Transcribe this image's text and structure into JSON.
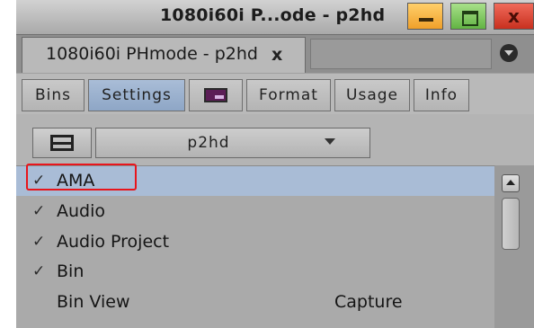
{
  "window": {
    "title": "1080i60i P...ode - p2hd",
    "close_glyph": "x"
  },
  "doc_tab": {
    "label": "1080i60i PHmode - p2hd",
    "close_glyph": "x"
  },
  "subtabs": [
    {
      "label": "Bins",
      "active": false
    },
    {
      "label": "Settings",
      "active": true
    },
    {
      "label": "",
      "icon": "monitor-icon",
      "active": false
    },
    {
      "label": "Format",
      "active": false
    },
    {
      "label": "Usage",
      "active": false
    },
    {
      "label": "Info",
      "active": false
    }
  ],
  "toolbar": {
    "view_toggle_icon": "split-view-icon",
    "settings_dropdown_value": "p2hd"
  },
  "settings_list": [
    {
      "label": "AMA",
      "checked": true,
      "value": "",
      "selected": true
    },
    {
      "label": "Audio",
      "checked": true,
      "value": ""
    },
    {
      "label": "Audio Project",
      "checked": true,
      "value": ""
    },
    {
      "label": "Bin",
      "checked": true,
      "value": ""
    },
    {
      "label": "Bin View",
      "checked": false,
      "value": "Capture"
    }
  ],
  "colors": {
    "selected_row": "#a9bcd6",
    "active_tab": "#a9bdd7",
    "highlight_box": "#e8151c",
    "minimize_button": "#f0a02a",
    "maximize_button": "#62b443",
    "close_button": "#c8301f"
  }
}
